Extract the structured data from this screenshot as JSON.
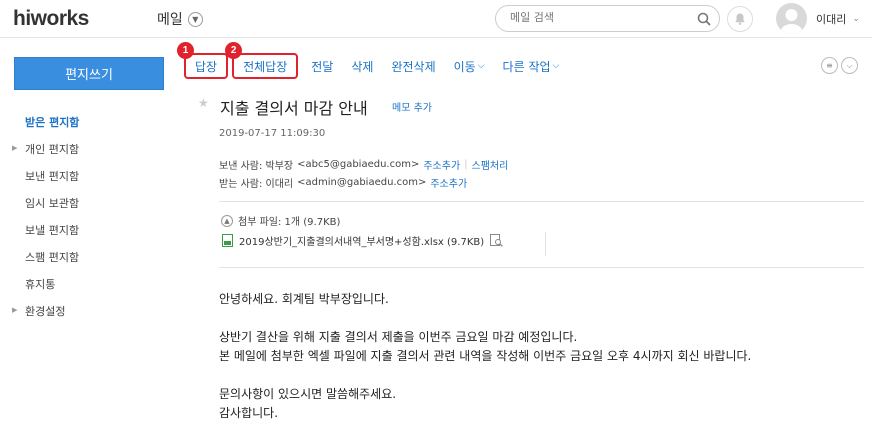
{
  "header": {
    "logo": "hiworks",
    "app_name": "메일",
    "search_placeholder": "메일 검색",
    "user_name": "이대리"
  },
  "sidebar": {
    "compose_label": "편지쓰기",
    "items": [
      {
        "label": "받은 편지함",
        "active": true,
        "expandable": false
      },
      {
        "label": "개인 편지함",
        "active": false,
        "expandable": true
      },
      {
        "label": "보낸 편지함",
        "active": false,
        "expandable": false
      },
      {
        "label": "임시 보관함",
        "active": false,
        "expandable": false
      },
      {
        "label": "보낼 편지함",
        "active": false,
        "expandable": false
      },
      {
        "label": "스팸 편지함",
        "active": false,
        "expandable": false
      },
      {
        "label": "휴지통",
        "active": false,
        "expandable": false
      },
      {
        "label": "환경설정",
        "active": false,
        "expandable": true
      }
    ]
  },
  "toolbar": {
    "reply": "답장",
    "reply_all": "전체답장",
    "forward": "전달",
    "delete": "삭제",
    "perm_delete": "완전삭제",
    "move": "이동",
    "more_actions": "다른 작업",
    "badge_1": "1",
    "badge_2": "2"
  },
  "mail": {
    "subject": "지출 결의서 마감 안내",
    "memo_add": "메모 추가",
    "date": "2019-07-17 11:09:30",
    "from_label": "보낸 사람: 박부장",
    "from_addr": "<abc5@gabiaedu.com>",
    "add_contact": "주소추가",
    "spam": "스팸처리",
    "to_label": "받는 사람: 이대리",
    "to_addr": "<admin@gabiaedu.com>",
    "attach_header": "첨부 파일: 1개 (9.7KB)",
    "attach_file": "2019상반기_지출결의서내역_부서명+성함.xlsx (9.7KB)",
    "body": [
      "안녕하세요. 회계팀 박부장입니다.",
      "상반기 결산을 위해 지출 결의서 제출을 이번주 금요일 마감 예정입니다.",
      "본 메일에 첨부한 엑셀 파일에 지출 결의서 관련 내역을 작성해 이번주 금요일 오후 4시까지 회신 바랍니다.",
      "문의사항이 있으시면 말씀해주세요.",
      "감사합니다."
    ]
  },
  "colors": {
    "accent": "#1a73c7",
    "compose_bg": "#3a8ee0",
    "highlight": "#e0222c"
  }
}
